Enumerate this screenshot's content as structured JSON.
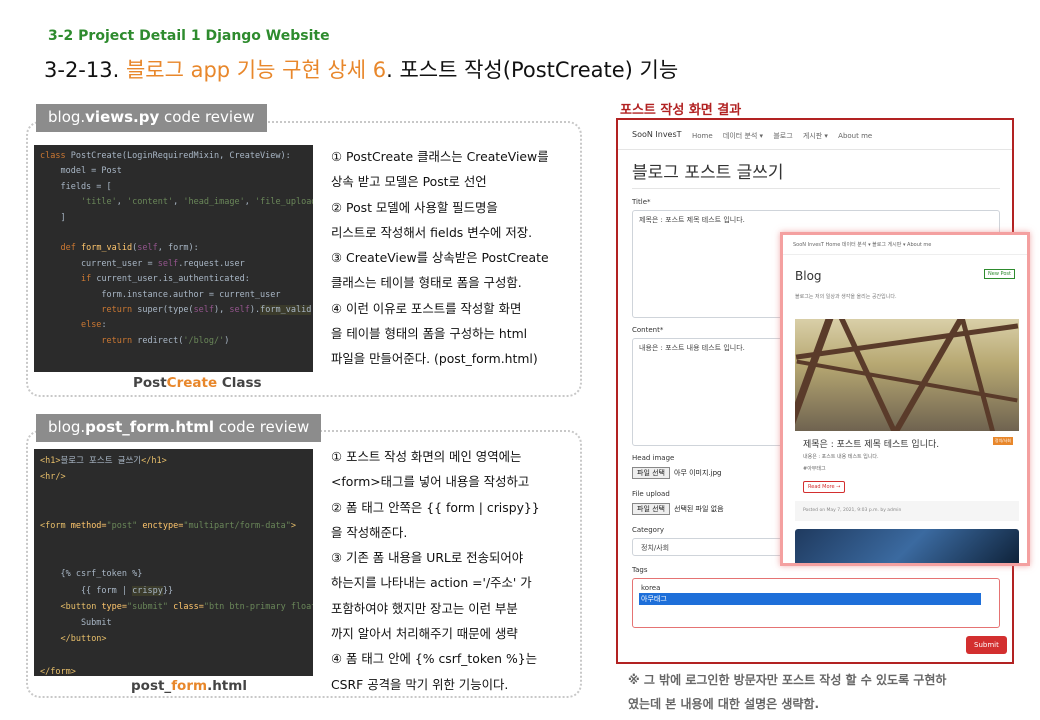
{
  "header": {
    "subtitle": "3-2 Project Detail 1 Django Website",
    "title_prefix": "3-2-13.",
    "title_highlight": "블로그 app 기능 구현 상세 6",
    "title_suffix": ". 포스트 작성(PostCreate) 기능"
  },
  "panel1": {
    "tag_prefix": "blog.",
    "tag_bold": "views.py",
    "tag_suffix": " code review",
    "caption_a": "Post",
    "caption_b": "Create",
    "caption_c": " Class",
    "desc": [
      "① PostCreate 클래스는 CreateView를",
      "상속 받고 모델은 Post로 선언",
      "② Post 모델에 사용할 필드명을",
      "리스트로 작성해서 fields 변수에 저장.",
      "③ CreateView를 상속받은 PostCreate",
      "클래스는 테이블 형태로 폼을 구성함.",
      "④ 이런 이유로 포스트를 작성할 화면",
      "을 테이블 형태의 폼을 구성하는 html",
      "파일을 만들어준다. (post_form.html)"
    ]
  },
  "panel2": {
    "tag_prefix": "blog.",
    "tag_bold": "post_form.html",
    "tag_suffix": " code review",
    "caption_a": "post_",
    "caption_b": "form",
    "caption_c": ".html",
    "desc": [
      "① 포스트 작성 화면의 메인 영역에는",
      "<form>태그를 넣어 내용을 작성하고",
      "② 폼 태그 안쪽은 {{ form | crispy}}",
      "을 작성해준다.",
      "③ 기존 폼 내용을 URL로 전송되어야",
      "하는지를 나타내는 action ='/주소' 가",
      "포함하여야 했지만 장고는 이런 부분",
      "까지 알아서 처리해주기 때문에 생략",
      "④ 폼 태그 안에 {% csrf_token %}는",
      "CSRF 공격을 막기 위한 기능이다."
    ]
  },
  "result": {
    "label": "포스트 작성 화면 결과",
    "nav_brand": "SooN InvesT",
    "nav_items": [
      "Home",
      "데이터 분석 ▾",
      "블로그",
      "게시판 ▾",
      "About me"
    ],
    "form_title": "블로그 포스트 글쓰기",
    "title_label": "Title*",
    "title_value": "제목은 : 포스트 제목 테스트 입니다.",
    "content_label": "Content*",
    "content_value": "내용은 : 포스트 내용 테스트 입니다.",
    "head_image_label": "Head image",
    "head_image_button": "파일 선택",
    "head_image_value": "아무 이미지.jpg",
    "file_upload_label": "File upload",
    "file_upload_button": "파일 선택",
    "file_upload_value": "선택된 파일 없음",
    "category_label": "Category",
    "category_value": "정치/사회",
    "tags_label": "Tags",
    "tags_options": [
      "korea",
      "아무태그"
    ],
    "submit_label": "Submit"
  },
  "overlay": {
    "nav_text": "SooN InvesT   Home  데이터 분석 ▾  블로그  게시판 ▾  About me",
    "title": "Blog",
    "new_post_btn": "New Post",
    "subtitle": "블로그는 저의 일상과 생각을 올리는 공간입니다.",
    "card_title": "제목은 : 포스트 제목 테스트 입니다.",
    "badge": "정치/사회",
    "card_content": "내용은 : 포스트 내용 테스트 입니다.",
    "card_tag": "#아무태그",
    "read_more": "Read More →",
    "footer": "Posted on May 7, 2021, 9:03 p.m. by admin"
  },
  "note": [
    "※ 그 밖에 로그인한 방문자만 포스트 작성 할 수 있도록 구현하",
    "였는데 본 내용에 대한 설명은 생략함."
  ],
  "colors": {
    "accent_orange": "#e8872b",
    "subtitle_green": "#2e8b2e",
    "result_red": "#b22222",
    "code_bg": "#2b2b2b"
  }
}
